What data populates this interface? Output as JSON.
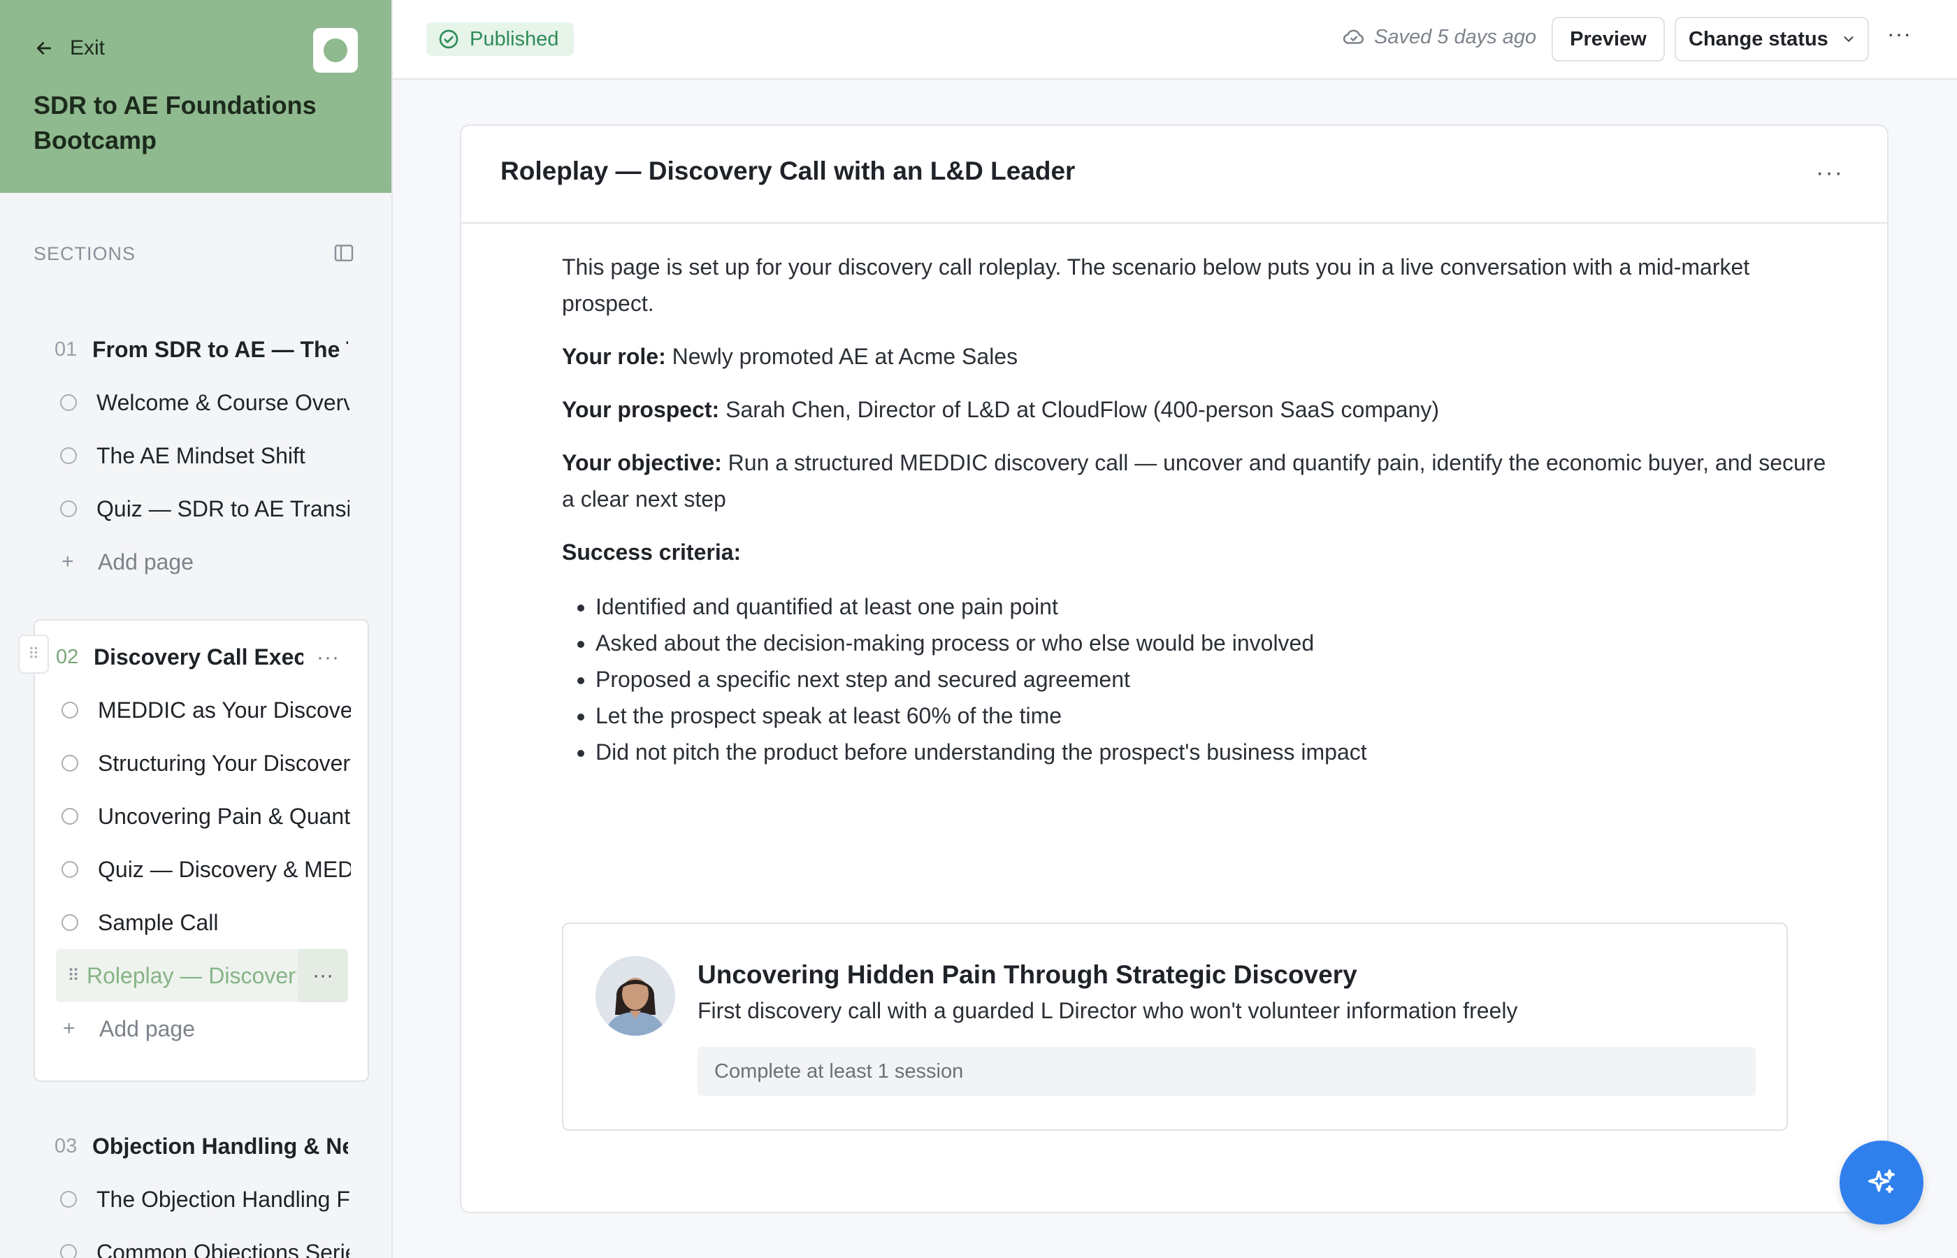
{
  "sidebar": {
    "exit_label": "Exit",
    "course_title": "SDR to AE Foundations Bootcamp",
    "sections_label": "SECTIONS",
    "sections": [
      {
        "number": "01",
        "title": "From SDR to AE — The Transition",
        "pages": [
          "Welcome & Course Overview",
          "The AE Mindset Shift",
          "Quiz — SDR to AE Transition"
        ],
        "add_page_label": "Add page"
      },
      {
        "number": "02",
        "title": "Discovery Call Execution",
        "pages": [
          "MEDDIC as Your Discovery Framework",
          "Structuring Your Discovery Call",
          "Uncovering Pain & Quantifying Impact",
          "Quiz — Discovery & MEDDIC",
          "Sample Call"
        ],
        "selected_page": "Roleplay — Discovery Call with an L&D Leader",
        "add_page_label": "Add page"
      },
      {
        "number": "03",
        "title": "Objection Handling & Negotiation",
        "pages": [
          "The Objection Handling Framework",
          "Common Objections Series"
        ]
      }
    ]
  },
  "topbar": {
    "status": "Published",
    "saved_text": "Saved 5 days ago",
    "preview_label": "Preview",
    "change_status_label": "Change status"
  },
  "page": {
    "title": "Roleplay — Discovery Call with an L&D Leader",
    "intro": "This page is set up for your discovery call roleplay. The scenario below puts you in a live conversation with a mid-market prospect.",
    "role_label": "Your role:",
    "role_value": " Newly promoted AE at Acme Sales",
    "prospect_label": "Your prospect:",
    "prospect_value": " Sarah Chen, Director of L&D at CloudFlow (400-person SaaS company)",
    "objective_label": "Your objective:",
    "objective_value": " Run a structured MEDDIC discovery call — uncover and quantify pain, identify the economic buyer, and secure a clear next step",
    "criteria_label": "Success criteria:",
    "criteria": [
      "Identified and quantified at least one pain point",
      "Asked about the decision-making process or who else would be involved",
      "Proposed a specific next step and secured agreement",
      "Let the prospect speak at least 60% of the time",
      "Did not pitch the product before understanding the prospect's business impact"
    ],
    "scenario": {
      "title": "Uncovering Hidden Pain Through Strategic Discovery",
      "subtitle": "First discovery call with a guarded L Director who won't volunteer information freely",
      "requirement": "Complete at least 1 session"
    }
  },
  "colors": {
    "brand_green": "#8fb98f",
    "status_green": "#2e8b57",
    "fab_blue": "#2f80ed"
  }
}
